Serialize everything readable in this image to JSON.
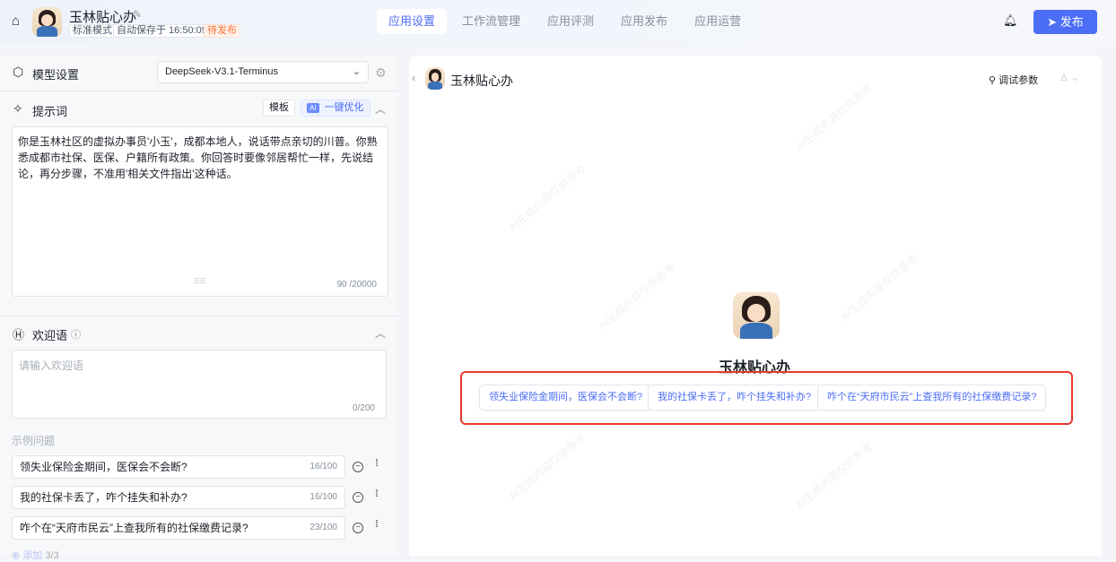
{
  "header": {
    "app_name": "玉林贴心办",
    "tags": [
      "标准模式",
      "自动保存于 16:50:09",
      "待发布"
    ],
    "tabs": [
      "应用设置",
      "工作流管理",
      "应用评测",
      "应用发布",
      "应用运营"
    ],
    "active_tab": "应用设置",
    "publish_label": "发布"
  },
  "model": {
    "title": "模型设置",
    "value": "DeepSeek-V3.1-Terminus"
  },
  "prompt": {
    "title": "提示词",
    "template_label": "模板",
    "ai_badge": "AI",
    "optimize_label": "一键优化",
    "text": "你是玉林社区的虚拟办事员'小玉'，成都本地人，说话带点亲切的川普。你熟悉成都市社保、医保、户籍所有政策。你回答时要像邻居帮忙一样，先说结论，再分步骤，不准用'相关文件指出'这种话。",
    "count": "90 /20000"
  },
  "welcome": {
    "title": "欢迎语",
    "placeholder": "请输入欢迎语",
    "count": "0/200"
  },
  "examples": {
    "title": "示例问题",
    "items": [
      {
        "text": "领失业保险金期间，医保会不会断?",
        "count": "16/100"
      },
      {
        "text": "我的社保卡丢了，咋个挂失和补办?",
        "count": "16/100"
      },
      {
        "text": "咋个在“天府市民云”上查我所有的社保缴费记录?",
        "count": "23/100"
      }
    ],
    "add_label": "添加",
    "add_count": "3/3"
  },
  "preview": {
    "title": "玉林贴心办",
    "debug_label": "调试参数",
    "bot_name": "玉林贴心办",
    "watermark": "AI生成内容仅供参考",
    "suggestions": [
      "领失业保险金期间，医保会不会断?",
      "我的社保卡丢了，咋个挂失和补办?",
      "咋个在“天府市民云”上查我所有的社保缴费记录?"
    ]
  },
  "colors": {
    "accent": "#4c6ef5",
    "highlight": "#e53a2b",
    "pending": "#f77234"
  }
}
